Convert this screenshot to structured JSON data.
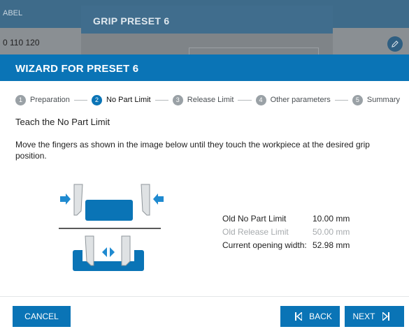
{
  "background": {
    "column_label": "ABEL",
    "row_value": "0 110 120",
    "dialog_title": "GRIP PRESET 6"
  },
  "wizard": {
    "title": "WIZARD FOR PRESET 6",
    "steps": [
      {
        "num": "1",
        "label": "Preparation"
      },
      {
        "num": "2",
        "label": "No Part Limit"
      },
      {
        "num": "3",
        "label": "Release Limit"
      },
      {
        "num": "4",
        "label": "Other parameters"
      },
      {
        "num": "5",
        "label": "Summary"
      }
    ],
    "active_step": 2,
    "section_title": "Teach the No Part Limit",
    "instructions": "Move the fingers as shown in the image below until they touch the workpiece at the desired grip position.",
    "params": [
      {
        "label": "Old No Part Limit",
        "value": "10.00 mm"
      },
      {
        "label": "Old Release Limit",
        "value": "50.00 mm"
      },
      {
        "label": "Current opening width:",
        "value": "52.98 mm"
      }
    ]
  },
  "buttons": {
    "cancel": "CANCEL",
    "back": "BACK",
    "next": "NEXT"
  },
  "colors": {
    "accent": "#0a74b6",
    "muted": "#a6aaad"
  },
  "icons": {
    "edit": "pencil-icon",
    "back": "skip-back-icon",
    "next": "skip-forward-icon"
  }
}
